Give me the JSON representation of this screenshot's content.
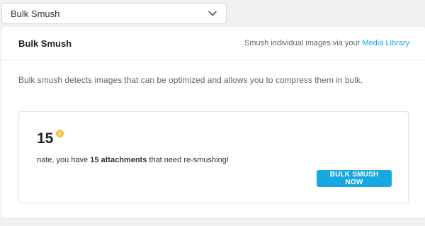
{
  "dropdown": {
    "selected": "Bulk Smush",
    "icon": "chevron-down-icon"
  },
  "box": {
    "title": "Bulk Smush",
    "header_text": "Smush individual images via your",
    "header_link": "Media Library",
    "intro": "Bulk smush detects images that can be optimized and allows you to compress them in bulk."
  },
  "stats": {
    "count": "15",
    "info_icon": "info-icon",
    "info_color": "#f5c242",
    "message_prefix": "nate, you have",
    "message_bold": "15 attachments",
    "message_suffix": "that need re-smushing!"
  },
  "button": {
    "label": "BULK SMUSH NOW",
    "color": "#17a8e3"
  }
}
